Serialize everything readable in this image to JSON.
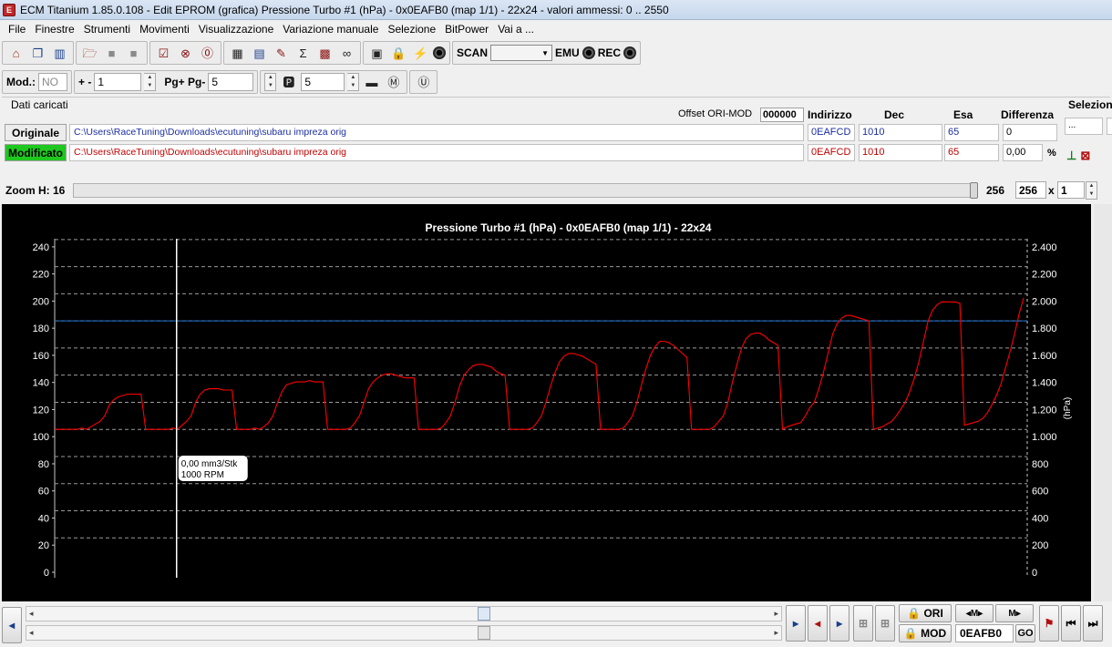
{
  "window": {
    "title": "ECM Titanium 1.85.0.108 - Edit EPROM (grafica) Pressione Turbo #1 (hPa) - 0x0EAFB0 (map 1/1) - 22x24 - valori ammessi: 0 .. 2550"
  },
  "menu": [
    "File",
    "Finestre",
    "Strumenti",
    "Movimenti",
    "Visualizzazione",
    "Variazione manuale",
    "Selezione",
    "BitPower",
    "Vai a ..."
  ],
  "toolbar": {
    "scan_label": "SCAN",
    "emu_label": "EMU",
    "rec_label": "REC"
  },
  "toolbar2": {
    "mod_label": "Mod.:",
    "mod_value": "NO",
    "plusminus_label": "+ -",
    "plusminus_value": "1",
    "pg_label": "Pg+ Pg-",
    "pg_value": "5",
    "p_value": "5"
  },
  "dati": {
    "title": "Dati caricati",
    "offset_label": "Offset ORI-MOD",
    "offset_value": "000000",
    "headers": {
      "indirizzo": "Indirizzo",
      "dec": "Dec",
      "esa": "Esa",
      "differenza": "Differenza"
    },
    "selezione_label": "Selezion",
    "sel_box": "...",
    "originale": {
      "label": "Originale",
      "path": "C:\\Users\\RaceTuning\\Downloads\\ecutuning\\subaru impreza orig",
      "indirizzo": "0EAFCD",
      "dec": "1010",
      "esa": "65",
      "differenza": "0"
    },
    "modificato": {
      "label": "Modificato",
      "path": "C:\\Users\\RaceTuning\\Downloads\\ecutuning\\subaru impreza orig",
      "indirizzo": "0EAFCD",
      "dec": "1010",
      "esa": "65",
      "differenza": "0,00",
      "pct": "%"
    }
  },
  "zoom": {
    "label": "Zoom H: 16",
    "value": "256",
    "box1": "256",
    "x": "x",
    "box2": "1"
  },
  "bottom": {
    "ori_label": "ORI",
    "mod_label": "MOD",
    "address": "0EAFB0",
    "go_label": "GO"
  },
  "colors": {
    "series": "#ff0000",
    "reference_line": "#1e6fd0",
    "cursor": "#ffffff",
    "modificato_bg": "#1ec81e"
  },
  "chart_data": {
    "type": "line",
    "title": "Pressione Turbo #1 (hPa) - 0x0EAFB0 (map 1/1) - 22x24",
    "ylabel_right": "(hPa)",
    "left_ticks": [
      "0",
      "20",
      "40",
      "60",
      "80",
      "100",
      "120",
      "140",
      "160",
      "180",
      "200",
      "220",
      "240"
    ],
    "right_ticks": [
      "0",
      "200",
      "400",
      "600",
      "800",
      "1.000",
      "1.200",
      "1.400",
      "1.600",
      "1.800",
      "2.000",
      "2.200",
      "2.400"
    ],
    "ylim_left": [
      0,
      250
    ],
    "ylim_right": [
      0,
      2500
    ],
    "grid": true,
    "reference_line_value": 1800,
    "cursor_label": [
      "0,00 mm3/Stk",
      "1000 RPM"
    ],
    "cursor_x_index": 28,
    "series": [
      {
        "values": [
          1000,
          1000,
          1000,
          1000,
          1000,
          1000,
          1010,
          1000,
          1020,
          1040,
          1060,
          1100,
          1180,
          1220,
          1240,
          1250,
          1260,
          1260,
          1260,
          1260,
          1000,
          1000,
          1000,
          1000,
          1000,
          1000,
          1010,
          1000,
          1030,
          1060,
          1100,
          1200,
          1260,
          1290,
          1300,
          1300,
          1300,
          1290,
          1290,
          1290,
          1000,
          1000,
          1000,
          1000,
          1010,
          1000,
          1020,
          1050,
          1100,
          1200,
          1280,
          1330,
          1340,
          1350,
          1350,
          1350,
          1360,
          1350,
          1350,
          1350,
          1000,
          1000,
          1000,
          1000,
          1000,
          1010,
          1050,
          1100,
          1200,
          1300,
          1350,
          1380,
          1400,
          1410,
          1410,
          1400,
          1390,
          1380,
          1380,
          1380,
          1000,
          1000,
          1000,
          1000,
          1000,
          1010,
          1050,
          1100,
          1200,
          1320,
          1400,
          1440,
          1470,
          1480,
          1480,
          1470,
          1460,
          1430,
          1410,
          1400,
          1000,
          1000,
          1000,
          1000,
          1000,
          1010,
          1050,
          1100,
          1200,
          1320,
          1420,
          1500,
          1540,
          1560,
          1560,
          1550,
          1540,
          1520,
          1500,
          1480,
          1000,
          1000,
          1000,
          1000,
          1000,
          1010,
          1050,
          1100,
          1200,
          1330,
          1450,
          1550,
          1610,
          1650,
          1650,
          1640,
          1620,
          1590,
          1560,
          1530,
          1000,
          1000,
          1000,
          1000,
          1000,
          1020,
          1060,
          1100,
          1200,
          1350,
          1480,
          1600,
          1670,
          1700,
          1710,
          1710,
          1690,
          1660,
          1640,
          1620,
          1000,
          1020,
          1030,
          1040,
          1050,
          1100,
          1160,
          1200,
          1300,
          1420,
          1560,
          1700,
          1780,
          1820,
          1840,
          1840,
          1830,
          1820,
          1810,
          1800,
          1000,
          1010,
          1020,
          1040,
          1060,
          1100,
          1150,
          1200,
          1280,
          1380,
          1500,
          1650,
          1800,
          1880,
          1920,
          1940,
          1940,
          1940,
          1940,
          1930,
          1030,
          1040,
          1050,
          1060,
          1080,
          1120,
          1180,
          1250,
          1330,
          1450,
          1570,
          1700,
          1850,
          1970
        ]
      }
    ]
  }
}
